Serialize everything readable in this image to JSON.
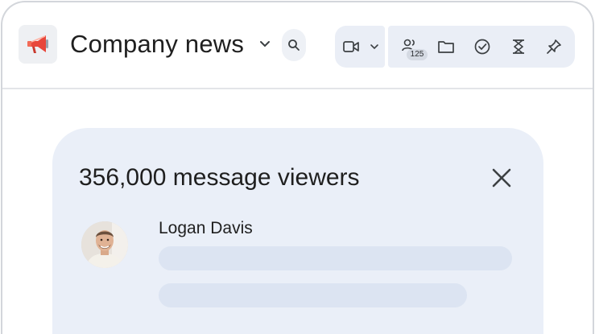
{
  "header": {
    "space_name": "Company news",
    "space_icon": "megaphone-icon",
    "member_count": "125",
    "toolbar_icons": [
      "video-call-icon",
      "chevron-down-icon",
      "members-icon",
      "files-icon",
      "tasks-icon",
      "integrations-icon",
      "pin-icon"
    ]
  },
  "viewers_panel": {
    "title": "356,000 message viewers",
    "viewers": [
      {
        "name": "Logan Davis"
      }
    ]
  },
  "colors": {
    "panel_background": "#eaeff8",
    "toolbar_background": "#eaeef6",
    "megaphone_accent": "#e8473b"
  }
}
